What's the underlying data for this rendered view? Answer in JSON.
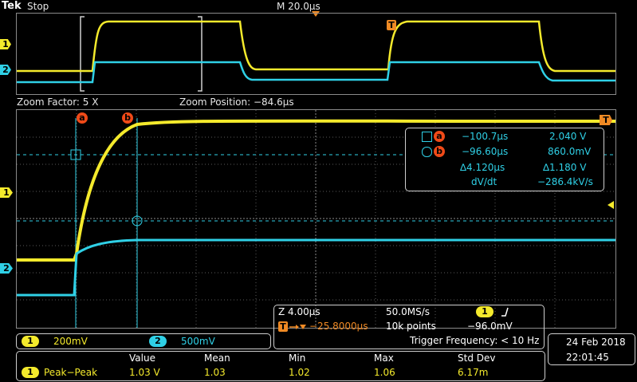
{
  "header": {
    "brand": "Tek",
    "run_state": "Stop",
    "timebase": "M 20.0µs"
  },
  "zoom_bar": {
    "zoom_factor": "Zoom Factor: 5 X",
    "zoom_position": "Zoom Position: −84.6µs"
  },
  "markers": {
    "ch1": "1",
    "ch2": "2",
    "trigger": "T",
    "cursor_a": "a",
    "cursor_b": "b"
  },
  "cursor_readout": {
    "a_time": "−100.7µs",
    "a_value": "2.040 V",
    "b_time": "−96.60µs",
    "b_value": "860.0mV",
    "delta_time": "∆4.120µs",
    "delta_value": "∆1.180 V",
    "slope_label": "dV/dt",
    "slope_value": "−286.4kV/s"
  },
  "channels": {
    "ch1_scale": "200mV",
    "ch2_scale": "500mV"
  },
  "acquisition": {
    "zoom_scale": "Z 4.00µs",
    "sample_rate": "50.0MS/s",
    "trigger_position": "−25.8000µs",
    "record_length": "10k points",
    "trigger_level": "−96.0mV",
    "trigger_frequency": "Trigger Frequency: < 10 Hz"
  },
  "datetime": {
    "date": "24 Feb  2018",
    "time": "22:01:45"
  },
  "measurements": {
    "headers": [
      "Value",
      "Mean",
      "Min",
      "Max",
      "Std Dev"
    ],
    "row": {
      "channel": "1",
      "name": "Peak−Peak",
      "value": "1.03 V",
      "mean": "1.03",
      "min": "1.02",
      "max": "1.06",
      "std_dev": "6.17m"
    }
  },
  "colors": {
    "ch1": "#f4ea2c",
    "ch2": "#2fd0e6",
    "cursor": "#f04a18",
    "trigger": "#f08a24",
    "grid": "#6a6a6a"
  }
}
